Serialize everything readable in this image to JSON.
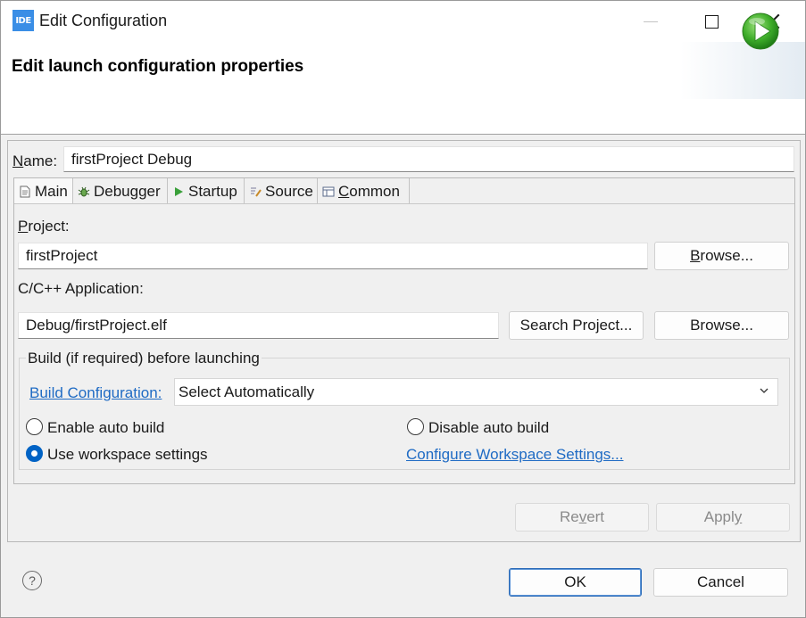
{
  "window": {
    "app_icon_text": "IDE",
    "title": "Edit Configuration"
  },
  "header": {
    "title": "Edit launch configuration properties"
  },
  "name": {
    "label": "Name:",
    "value": "firstProject Debug"
  },
  "tabs": [
    {
      "label": "Main",
      "icon": "document-icon",
      "active": true
    },
    {
      "label": "Debugger",
      "icon": "bug-icon",
      "active": false
    },
    {
      "label": "Startup",
      "icon": "play-arrow-icon",
      "active": false
    },
    {
      "label": "Source",
      "icon": "source-icon",
      "active": false
    },
    {
      "label": "Common",
      "icon": "common-icon",
      "active": false
    }
  ],
  "main": {
    "project_label": "Project:",
    "project_value": "firstProject",
    "project_browse": "Browse...",
    "app_label": "C/C++ Application:",
    "app_value": "Debug/firstProject.elf",
    "search_project": "Search Project...",
    "app_browse": "Browse..."
  },
  "build": {
    "group_title": "Build (if required) before launching",
    "config_link": "Build Configuration:",
    "config_value": "Select Automatically",
    "enable_auto": "Enable auto build",
    "disable_auto": "Disable auto build",
    "use_workspace": "Use workspace settings",
    "configure_link": "Configure Workspace Settings...",
    "selected": "use_workspace"
  },
  "actions": {
    "revert": "Revert",
    "apply": "Apply",
    "ok": "OK",
    "cancel": "Cancel"
  },
  "colors": {
    "accent": "#0063c5",
    "link": "#1f6bc4"
  }
}
